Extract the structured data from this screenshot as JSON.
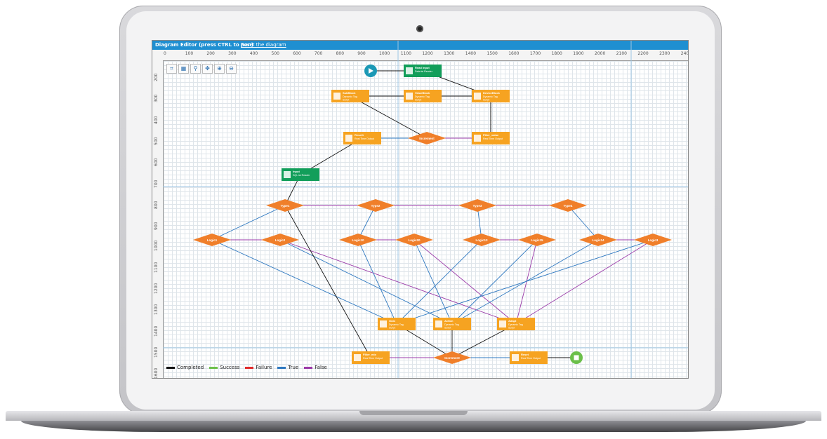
{
  "window": {
    "title": "Diagram Editor (press CTRL to pan)",
    "reset_link": "Reset the diagram"
  },
  "ruler_x": [
    "0",
    "100",
    "200",
    "300",
    "400",
    "500",
    "600",
    "700",
    "800",
    "900",
    "1000",
    "1100",
    "1200",
    "1300",
    "1400",
    "1500",
    "1600",
    "1700",
    "1800",
    "1900",
    "2000",
    "2100",
    "2200",
    "2300",
    "2400"
  ],
  "ruler_y": [
    "200",
    "300",
    "400",
    "500",
    "600",
    "700",
    "800",
    "900",
    "1000",
    "1100",
    "1200",
    "1300",
    "1400",
    "1500",
    "1600"
  ],
  "toolbar": [
    {
      "icon": "fit-icon",
      "glyph": "⌗"
    },
    {
      "icon": "grid-icon",
      "glyph": "▦"
    },
    {
      "icon": "layout-icon",
      "glyph": "⚲"
    },
    {
      "icon": "pan-icon",
      "glyph": "✥"
    },
    {
      "icon": "zoom-in-icon",
      "glyph": "⊕"
    },
    {
      "icon": "zoom-out-icon",
      "glyph": "⊖"
    }
  ],
  "colors": {
    "orange": "#f6a321",
    "diamond": "#f07f2a",
    "green": "#129e5a",
    "teal": "#1a98b5",
    "end": "#6bbf4a",
    "completed": "#111111",
    "success": "#6cc04a",
    "failure": "#e02b2b",
    "true": "#2e78c0",
    "false": "#9b3aa8"
  },
  "nodes": [
    {
      "id": "start",
      "kind": "start"
    },
    {
      "id": "n_input_top",
      "kind": "green",
      "title": "Read Input",
      "sub": "Data ist Reader"
    },
    {
      "id": "n_sub1",
      "kind": "task",
      "title": "SubBlock",
      "sub": "Dynamic Tag",
      "sub2": "Script"
    },
    {
      "id": "n_sub2",
      "kind": "task",
      "title": "ValueBlock",
      "sub": "Dynamic Tag",
      "sub2": "Script"
    },
    {
      "id": "n_sub3",
      "kind": "task",
      "title": "DeviceBlock",
      "sub": "Dynamic Tag",
      "sub2": "Script"
    },
    {
      "id": "n_reset1",
      "kind": "task",
      "title": "Reset1",
      "sub": "Real Time Output"
    },
    {
      "id": "d_top",
      "kind": "diamond",
      "title": "Increment"
    },
    {
      "id": "n_filter",
      "kind": "task",
      "title": "Filter_value",
      "sub": "Real Time Output"
    },
    {
      "id": "n_input",
      "kind": "green",
      "title": "Input",
      "sub": "SQL ist Reader"
    },
    {
      "id": "d_t1",
      "kind": "diamond",
      "title": "Type1"
    },
    {
      "id": "d_t2",
      "kind": "diamond",
      "title": "Type2"
    },
    {
      "id": "d_t3",
      "kind": "diamond",
      "title": "Type3"
    },
    {
      "id": "d_t4",
      "kind": "diamond",
      "title": "Type4"
    },
    {
      "id": "d_l1",
      "kind": "diamond",
      "title": "Logic1"
    },
    {
      "id": "d_l2",
      "kind": "diamond",
      "title": "Logic2"
    },
    {
      "id": "d_l3",
      "kind": "diamond",
      "title": "Logic10"
    },
    {
      "id": "d_l4",
      "kind": "diamond",
      "title": "Logic20"
    },
    {
      "id": "d_l5",
      "kind": "diamond",
      "title": "Logic13"
    },
    {
      "id": "d_l6",
      "kind": "diamond",
      "title": "Logic15"
    },
    {
      "id": "d_l7",
      "kind": "diamond",
      "title": "Logic14"
    },
    {
      "id": "d_l8",
      "kind": "diamond",
      "title": "Logic3"
    },
    {
      "id": "n_out1",
      "kind": "task",
      "title": "Out1",
      "sub": "Dynamic Tag",
      "sub2": "Script"
    },
    {
      "id": "n_out2",
      "kind": "task",
      "title": "Action",
      "sub": "Dynamic Tag",
      "sub2": "Script"
    },
    {
      "id": "n_out3",
      "kind": "task",
      "title": "Adapt",
      "sub": "Dynamic Tag",
      "sub2": "Script"
    },
    {
      "id": "n_filter2",
      "kind": "task",
      "title": "Filter_mix",
      "sub": "Real Time Output"
    },
    {
      "id": "d_bottom",
      "kind": "diamond",
      "title": "Increment"
    },
    {
      "id": "n_reset2",
      "kind": "task",
      "title": "Reset",
      "sub": "Real Time Output"
    },
    {
      "id": "end",
      "kind": "end"
    }
  ],
  "legend": [
    {
      "label": "Completed",
      "color": "#111111"
    },
    {
      "label": "Success",
      "color": "#6cc04a"
    },
    {
      "label": "Failure",
      "color": "#e02b2b"
    },
    {
      "label": "True",
      "color": "#2e78c0"
    },
    {
      "label": "False",
      "color": "#9b3aa8"
    }
  ]
}
